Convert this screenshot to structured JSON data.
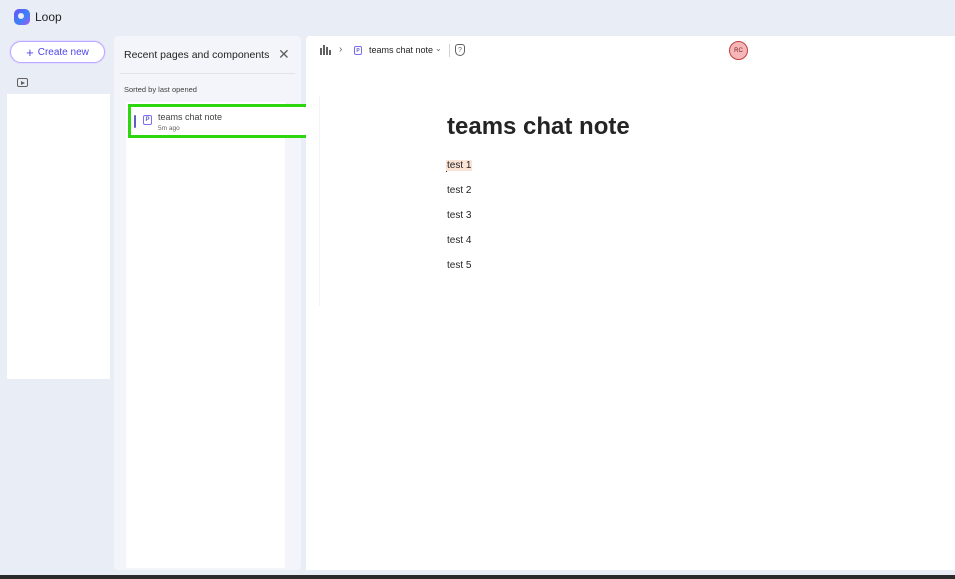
{
  "app": {
    "name": "Loop"
  },
  "sidebar": {
    "create_label": "Create new"
  },
  "recent": {
    "title": "Recent pages and components",
    "sort_label": "Sorted by last opened",
    "items": [
      {
        "title": "teams chat note",
        "time": "5m ago"
      }
    ]
  },
  "breadcrumb": {
    "page": "teams chat note"
  },
  "user": {
    "initials": "RC"
  },
  "document": {
    "title": "teams chat note",
    "paragraphs": [
      "test 1",
      "test 2",
      "test 3",
      "test 4",
      "test 5"
    ]
  },
  "colors": {
    "accent": "#5b5fc7",
    "highlight": "#2ed60f",
    "avatar_bg": "#f4b6b6"
  },
  "icons": [
    "loop-logo-icon",
    "plus-icon",
    "video-icon",
    "close-icon",
    "page-icon",
    "home-icon",
    "chevron-right-icon",
    "chevron-down-icon",
    "shield-icon"
  ]
}
